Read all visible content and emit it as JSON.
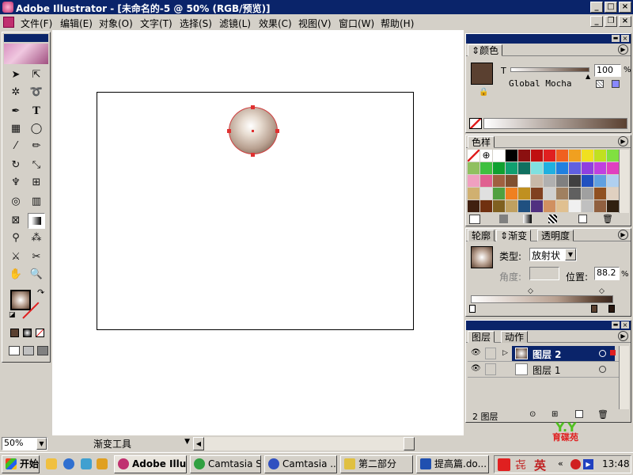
{
  "window": {
    "title": "Adobe Illustrator - [未命名的-5 @ 50% (RGB/预览)]"
  },
  "menu": [
    "文件(F)",
    "编辑(E)",
    "对象(O)",
    "文字(T)",
    "选择(S)",
    "滤镜(L)",
    "效果(C)",
    "视图(V)",
    "窗口(W)",
    "帮助(H)"
  ],
  "color_panel": {
    "tab": "颜色",
    "t_label": "T",
    "tint_value": "100",
    "percent": "%",
    "color_name": "Global Mocha",
    "swatch_color": "#5a4030"
  },
  "swatches_panel": {
    "tab": "色样"
  },
  "gradient_panel": {
    "tabs": [
      "轮廓",
      "渐变",
      "透明度"
    ],
    "type_label": "类型:",
    "type_value": "放射状",
    "angle_label": "角度:",
    "location_label": "位置:",
    "location_value": "88.2",
    "percent": "%"
  },
  "layers_panel": {
    "tabs": [
      "图层",
      "动作"
    ],
    "layers": [
      {
        "name": "图层 2",
        "selected": true
      },
      {
        "name": "图层 1",
        "selected": false
      }
    ],
    "count": "2 图层"
  },
  "status": {
    "zoom": "50%",
    "tool": "渐变工具"
  },
  "taskbar": {
    "start": "开始",
    "items": [
      "Adobe Illus...",
      "Camtasia S...",
      "Camtasia ...",
      "第二部分",
      "提高篇.do..."
    ],
    "ime": "英",
    "time": "13:48"
  },
  "watermark": "育碟苑",
  "colors": {
    "title_bg": "#0a246a",
    "face": "#d4d0c8",
    "mocha": "#5a4030"
  }
}
